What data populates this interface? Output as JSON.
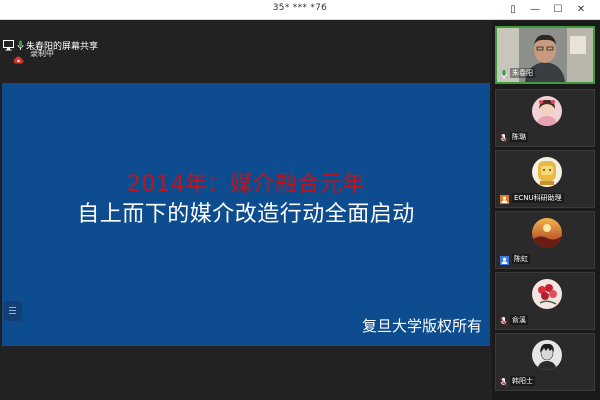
{
  "window": {
    "title": "35* *** *76",
    "controls": {
      "tile": "▯",
      "minimize": "—",
      "maximize": "☐",
      "close": "✕"
    }
  },
  "recording": {
    "label": "录制中",
    "icon": "cloud-record-icon",
    "color": "#d9342b"
  },
  "slide": {
    "line1": "2014年：媒介融合元年",
    "line2": "自上而下的媒介改造行动全面启动",
    "copyright": "复旦大学版权所有",
    "background": "#0d4d8f",
    "line1_color": "#c0141a"
  },
  "screen_share": {
    "label": "朱春阳的屏幕共享",
    "icon": "screen-share-icon"
  },
  "participants": [
    {
      "name": "朱春阳",
      "status_icon": "microphone-active-icon",
      "has_video": true
    },
    {
      "name": "陈璐",
      "status_icon": "microphone-muted-icon"
    },
    {
      "name": "ECNU科研助理",
      "status_icon": "user-icon"
    },
    {
      "name": "陈虹",
      "status_icon": "user-icon"
    },
    {
      "name": "俞溪",
      "status_icon": "microphone-muted-icon"
    },
    {
      "name": "韩阳士",
      "status_icon": "microphone-muted-icon"
    }
  ],
  "colors": {
    "active_speaker_border": "#3e9b3e",
    "ecnu_badge": "#e07a1f",
    "chenhong_badge": "#3a7bd5"
  }
}
